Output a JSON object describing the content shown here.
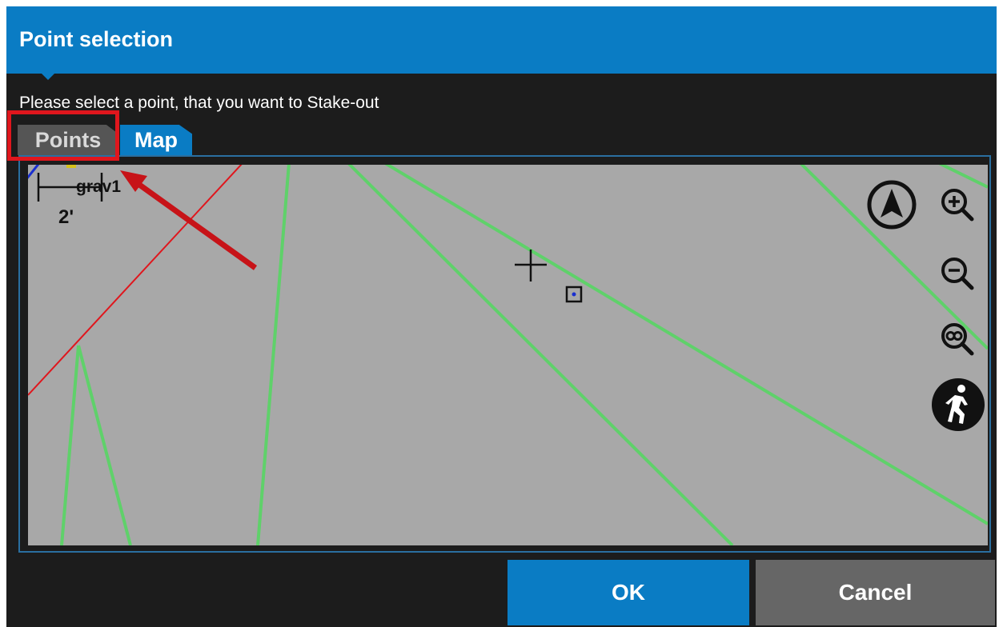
{
  "dialog": {
    "title": "Point selection",
    "instruction": "Please select a point, that you want to Stake-out"
  },
  "tabs": [
    {
      "label": "Points",
      "active": false
    },
    {
      "label": "Map",
      "active": true
    }
  ],
  "map": {
    "point_label": "grav1",
    "scale_label": "2'",
    "tools": [
      {
        "icon": "north-arrow-icon"
      },
      {
        "icon": "zoom-in-icon"
      },
      {
        "icon": "zoom-out-icon"
      },
      {
        "icon": "zoom-extents-icon"
      },
      {
        "icon": "walk-icon"
      }
    ]
  },
  "buttons": {
    "ok_label": "OK",
    "cancel_label": "Cancel"
  },
  "colors": {
    "accent": "#0a7cc4",
    "highlight": "#e0161d",
    "line_green": "#5fd16a",
    "line_red": "#e0161d"
  }
}
